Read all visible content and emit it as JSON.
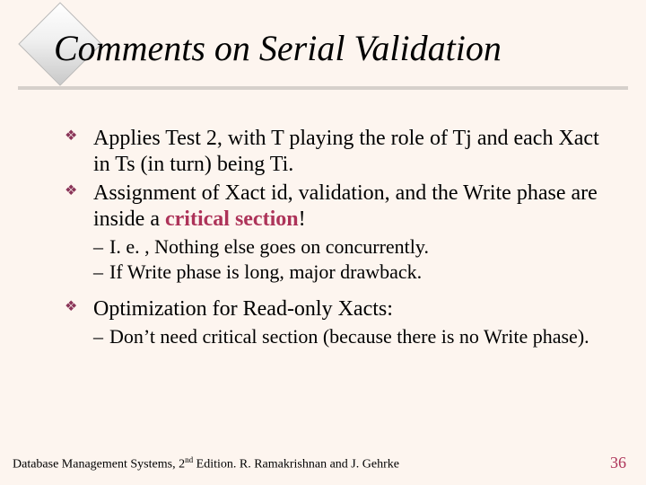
{
  "title": "Comments on Serial Validation",
  "bullets": {
    "b1": "Applies Test 2, with T playing the role of Tj and each Xact in Ts (in turn) being Ti.",
    "b2a": "Assignment of Xact id, validation, and the Write phase are inside a ",
    "b2_crit": "critical section",
    "b2b": "!",
    "s1": "I. e. , Nothing else goes on concurrently.",
    "s2": "If Write phase is long, major drawback.",
    "b3": "Optimization for Read-only Xacts:",
    "s3": "Don’t need critical section (because there is no Write phase)."
  },
  "footer": {
    "text_a": "Database Management Systems, 2",
    "text_sup": "nd",
    "text_b": " Edition.  R. Ramakrishnan and J. Gehrke",
    "page": "36"
  },
  "bullet_glyph": "❖",
  "dash": "–"
}
